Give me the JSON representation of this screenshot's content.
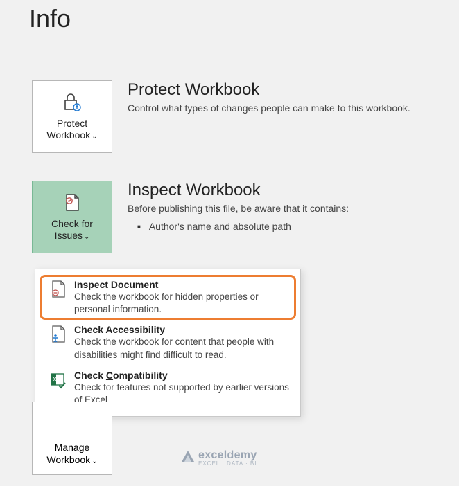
{
  "page_title": "Info",
  "protect": {
    "tile_line1": "Protect",
    "tile_line2": "Workbook",
    "heading": "Protect Workbook",
    "desc": "Control what types of changes people can make to this workbook."
  },
  "inspect": {
    "tile_line1": "Check for",
    "tile_line2": "Issues",
    "heading": "Inspect Workbook",
    "desc": "Before publishing this file, be aware that it contains:",
    "bullet1": "Author's name and absolute path"
  },
  "dropdown": {
    "item1": {
      "title_pre": "I",
      "title_rest": "nspect Document",
      "desc": "Check the workbook for hidden properties or personal information."
    },
    "item2": {
      "title_pre": "Check ",
      "title_u": "A",
      "title_rest": "ccessibility",
      "desc": "Check the workbook for content that people with disabilities might find difficult to read."
    },
    "item3": {
      "title_pre": "Check ",
      "title_u": "C",
      "title_rest": "ompatibility",
      "desc": "Check for features not supported by earlier versions of Excel."
    }
  },
  "manage": {
    "tile_line1": "Manage",
    "tile_line2": "Workbook"
  },
  "watermark": {
    "text": "exceldemy",
    "sub": "EXCEL · DATA · BI"
  }
}
